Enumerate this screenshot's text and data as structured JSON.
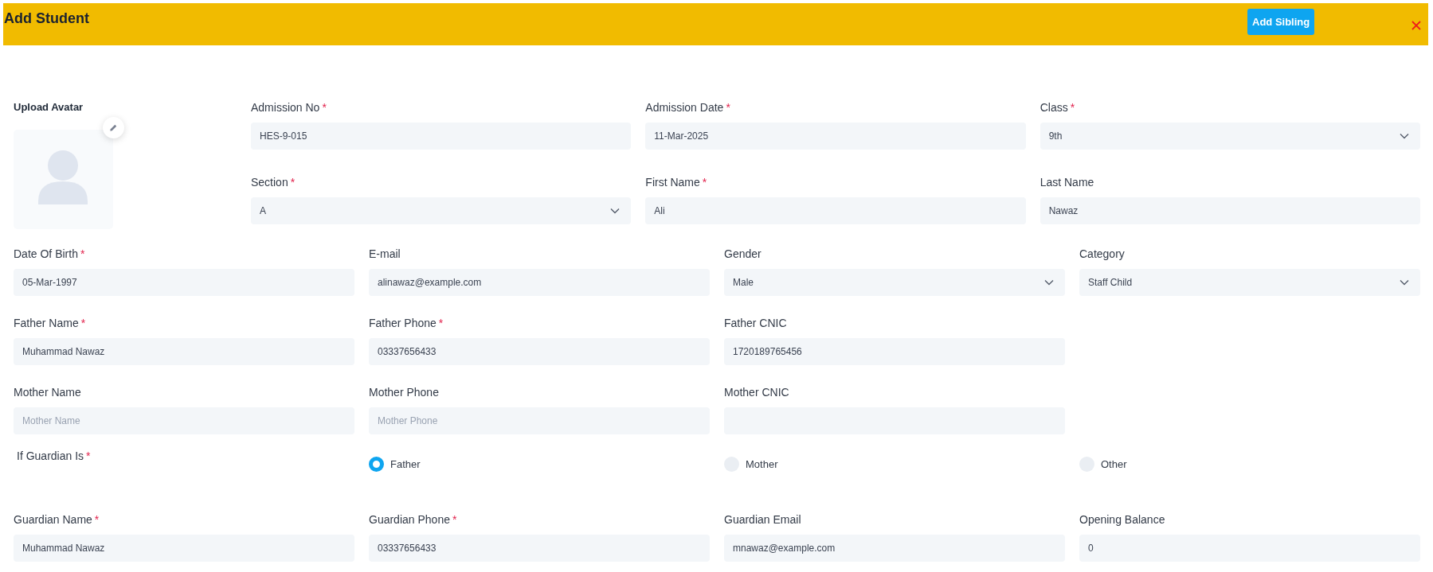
{
  "header": {
    "title": "Add Student",
    "button": "Add Sibling"
  },
  "avatar": {
    "label": "Upload Avatar"
  },
  "top_fields": [
    {
      "label": "Admission No",
      "required": "*",
      "kind": "text",
      "value": "HES-9-015"
    },
    {
      "label": "Admission Date",
      "required": "*",
      "kind": "text",
      "value": "11-Mar-2025"
    },
    {
      "label": "Class",
      "required": "*",
      "kind": "select",
      "value": "9th"
    },
    {
      "label": "Section",
      "required": "*",
      "kind": "select",
      "value": "A"
    },
    {
      "label": "First Name",
      "required": "*",
      "kind": "text",
      "value": "Ali"
    },
    {
      "label": "Last Name",
      "kind": "text",
      "value": "Nawaz"
    }
  ],
  "rows": [
    [
      {
        "label": "Date Of Birth",
        "required": "*",
        "kind": "text",
        "value": "05-Mar-1997"
      },
      {
        "label": "E-mail",
        "kind": "text",
        "value": "alinawaz@example.com"
      },
      {
        "label": "Gender",
        "kind": "select",
        "value": "Male"
      },
      {
        "label": "Category",
        "kind": "select",
        "value": "Staff Child"
      }
    ],
    [
      {
        "label": "Father Name",
        "required": "*",
        "kind": "text",
        "value": "Muhammad Nawaz"
      },
      {
        "label": "Father Phone",
        "required": "*",
        "kind": "text",
        "value": "03337656433"
      },
      {
        "label": "Father CNIC",
        "kind": "text",
        "value": "1720189765456"
      }
    ],
    [
      {
        "label": "Mother Name",
        "kind": "text",
        "placeholder": "Mother Name"
      },
      {
        "label": "Mother Phone",
        "kind": "text",
        "placeholder": "Mother Phone"
      },
      {
        "label": "Mother CNIC",
        "kind": "text"
      }
    ]
  ],
  "guardian": {
    "label": "If Guardian Is",
    "required": "*",
    "options": [
      {
        "label": "Father",
        "selected": true
      },
      {
        "label": "Mother",
        "selected": false
      },
      {
        "label": "Other",
        "selected": false
      }
    ]
  },
  "guardian_fields": [
    {
      "label": "Guardian Name",
      "required": "*",
      "value": "Muhammad Nawaz"
    },
    {
      "label": "Guardian Phone",
      "required": "*",
      "value": "03337656433"
    },
    {
      "label": "Guardian Email",
      "value": "mnawaz@example.com"
    },
    {
      "label": "Opening Balance",
      "value": "0"
    }
  ]
}
